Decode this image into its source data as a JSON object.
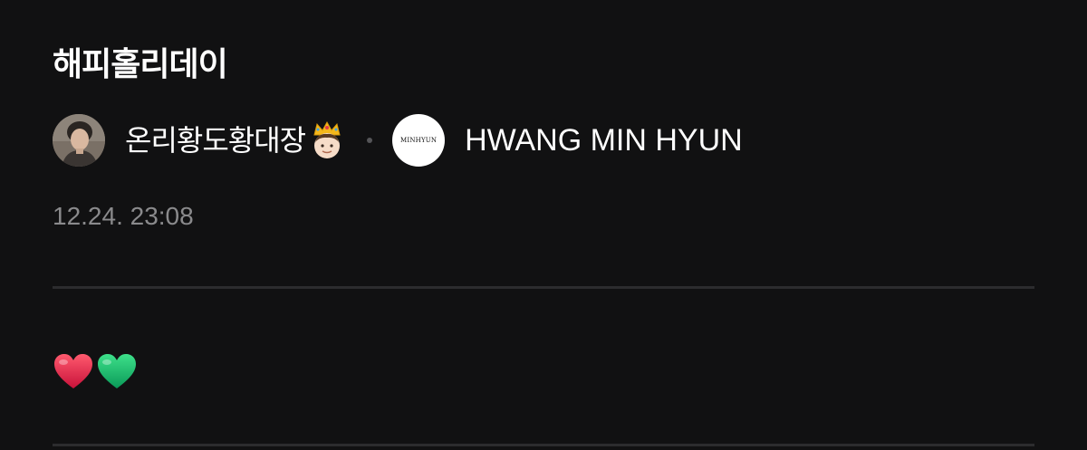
{
  "post": {
    "title": "해피홀리데이",
    "author": {
      "name": "온리황도황대장",
      "badge_emoji": "crown-face-emoji"
    },
    "channel": {
      "logo_text": "MINHYUN",
      "name": "HWANG MIN HYUN"
    },
    "timestamp": "12.24. 23:08",
    "body": {
      "emojis": [
        "red-heart-emoji",
        "green-heart-emoji"
      ]
    }
  },
  "colors": {
    "background": "#111112",
    "text": "#ffffff",
    "muted": "#8a8a8c",
    "divider": "#2c2c2e",
    "red_heart": "#e8304e",
    "green_heart": "#1ec46a"
  }
}
